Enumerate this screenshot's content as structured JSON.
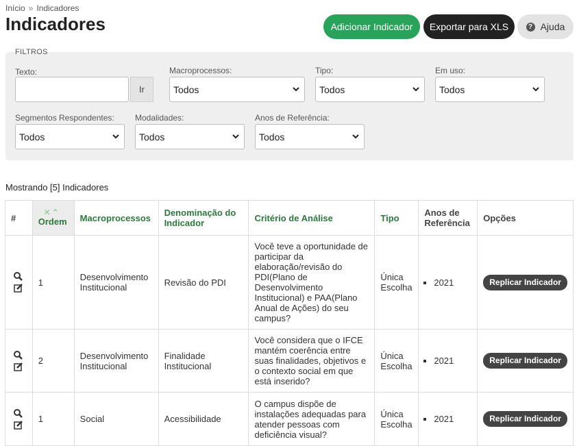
{
  "breadcrumb": {
    "home": "Início",
    "separator": "»",
    "current": "Indicadores"
  },
  "page_title": "Indicadores",
  "actions": {
    "add_label": "Adicionar Indicador",
    "export_label": "Exportar para XLS",
    "help_label": "Ajuda",
    "add_color": "#27a35a"
  },
  "filters": {
    "title": "FILTROS",
    "texto_label": "Texto:",
    "texto_value": "",
    "go_label": "Ir",
    "macro_label": "Macroprocessos:",
    "macro_value": "Todos",
    "tipo_label": "Tipo:",
    "tipo_value": "Todos",
    "emuso_label": "Em uso:",
    "emuso_value": "Todos",
    "segmentos_label": "Segmentos Respondentes:",
    "segmentos_value": "Todos",
    "modalidades_label": "Modalidades:",
    "modalidades_value": "Todos",
    "anos_label": "Anos de Referência:",
    "anos_value": "Todos"
  },
  "showing_text": "Mostrando [5] Indicadores",
  "table": {
    "headers": {
      "hash": "#",
      "ordem": "Ordem",
      "macro": "Macroprocessos",
      "denom": "Denominação do Indicador",
      "criterio": "Critério de Análise",
      "tipo": "Tipo",
      "anos": "Anos de Referência",
      "opcoes": "Opções"
    },
    "rows": [
      {
        "ordem": "1",
        "macro": "Desenvolvimento Institucional",
        "denom": "Revisão do PDI",
        "criterio": "Você teve a oportunidade de participar da elaboração/revisão do PDI(Plano de Desenvolvimento Institucional) e PAA(Plano Anual de Ações) do seu campus?",
        "tipo": "Única Escolha",
        "ano": "2021",
        "button": "Replicar Indicador"
      },
      {
        "ordem": "2",
        "macro": "Desenvolvimento Institucional",
        "denom": "Finalidade Institucional",
        "criterio": "Você considera que o IFCE mantém coerência entre suas finalidades, objetivos e o contexto social em que está inserido?",
        "tipo": "Única Escolha",
        "ano": "2021",
        "button": "Replicar Indicador"
      },
      {
        "ordem": "1",
        "macro": "Social",
        "denom": "Acessibilidade",
        "criterio": "O campus dispõe de instalações adequadas para atender pessoas com deficiência visual?",
        "tipo": "Única Escolha",
        "ano": "2021",
        "button": "Replicar Indicador"
      }
    ]
  }
}
